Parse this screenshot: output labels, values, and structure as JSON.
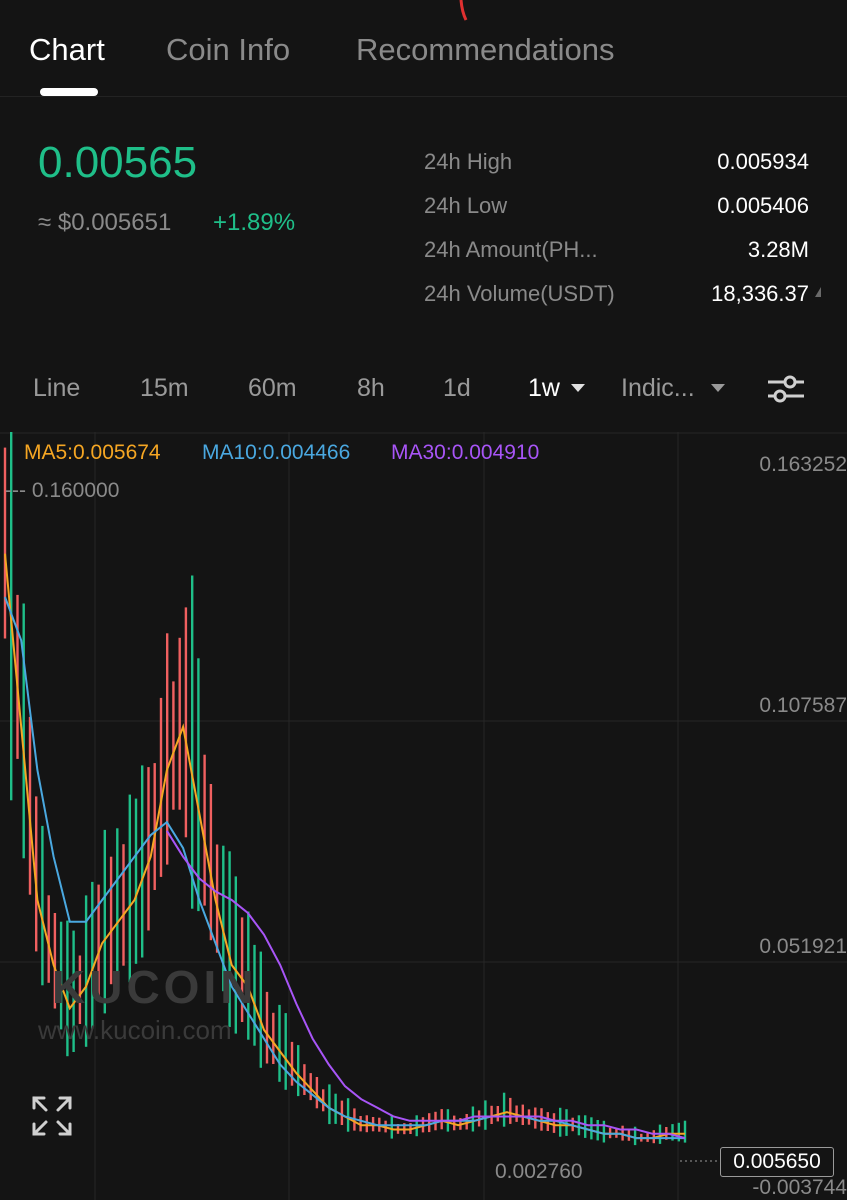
{
  "tabs": [
    {
      "label": "Chart",
      "active": true
    },
    {
      "label": "Coin Info",
      "active": false
    },
    {
      "label": "Recommendations",
      "active": false
    }
  ],
  "ticker": {
    "price": "0.00565",
    "fiat": "≈ $0.005651",
    "change": "+1.89%"
  },
  "stats": [
    {
      "label": "24h High",
      "value": "0.005934"
    },
    {
      "label": "24h Low",
      "value": "0.005406"
    },
    {
      "label": "24h Amount(PH...",
      "value": "3.28M"
    },
    {
      "label": "24h Volume(USDT)",
      "value": "18,336.37"
    }
  ],
  "timeframes": {
    "items": [
      "Line",
      "15m",
      "60m",
      "8h",
      "1d",
      "1w",
      "Indic..."
    ],
    "selected": "1w"
  },
  "indicators": {
    "ma5": "MA5:0.005674",
    "ma10": "MA10:0.004466",
    "ma30": "MA30:0.004910"
  },
  "watermark": {
    "brand": "KUCOIN",
    "url": "www.kucoin.com"
  },
  "chart_data": {
    "type": "line",
    "y_axis_labels": [
      "0.163252",
      "0.107587",
      "0.051921",
      "-0.003744"
    ],
    "high_label": "--- 0.160000",
    "low_label": "0.002760",
    "current_price_label": "0.005650",
    "ylim": [
      -0.003744,
      0.163252
    ],
    "series": [
      {
        "name": "MA5",
        "color": "#f5a623",
        "values": [
          0.14,
          0.1,
          0.06,
          0.045,
          0.035,
          0.04,
          0.05,
          0.055,
          0.06,
          0.07,
          0.09,
          0.1,
          0.08,
          0.06,
          0.045,
          0.04,
          0.03,
          0.025,
          0.02,
          0.016,
          0.012,
          0.01,
          0.008,
          0.008,
          0.007,
          0.007,
          0.008,
          0.009,
          0.008,
          0.009,
          0.01,
          0.011,
          0.01,
          0.009,
          0.008,
          0.008,
          0.007,
          0.006,
          0.006,
          0.005,
          0.005,
          0.006,
          0.006
        ]
      },
      {
        "name": "MA10",
        "color": "#4aa8e0",
        "values": [
          0.13,
          0.12,
          0.09,
          0.07,
          0.055,
          0.055,
          0.06,
          0.065,
          0.07,
          0.075,
          0.078,
          0.072,
          0.06,
          0.05,
          0.04,
          0.034,
          0.028,
          0.022,
          0.018,
          0.015,
          0.012,
          0.01,
          0.009,
          0.008,
          0.008,
          0.008,
          0.008,
          0.009,
          0.009,
          0.009,
          0.01,
          0.01,
          0.01,
          0.009,
          0.009,
          0.008,
          0.007,
          0.006,
          0.006,
          0.005,
          0.005,
          0.005,
          0.005
        ]
      },
      {
        "name": "MA30",
        "color": "#a855f7",
        "values": [
          null,
          null,
          null,
          null,
          null,
          null,
          null,
          null,
          null,
          null,
          0.076,
          0.07,
          0.065,
          0.062,
          0.06,
          0.057,
          0.052,
          0.045,
          0.036,
          0.028,
          0.022,
          0.017,
          0.014,
          0.012,
          0.01,
          0.009,
          0.009,
          0.009,
          0.009,
          0.01,
          0.01,
          0.01,
          0.01,
          0.01,
          0.009,
          0.009,
          0.008,
          0.008,
          0.007,
          0.007,
          0.006,
          0.006,
          0.005
        ]
      }
    ],
    "grid": true
  }
}
